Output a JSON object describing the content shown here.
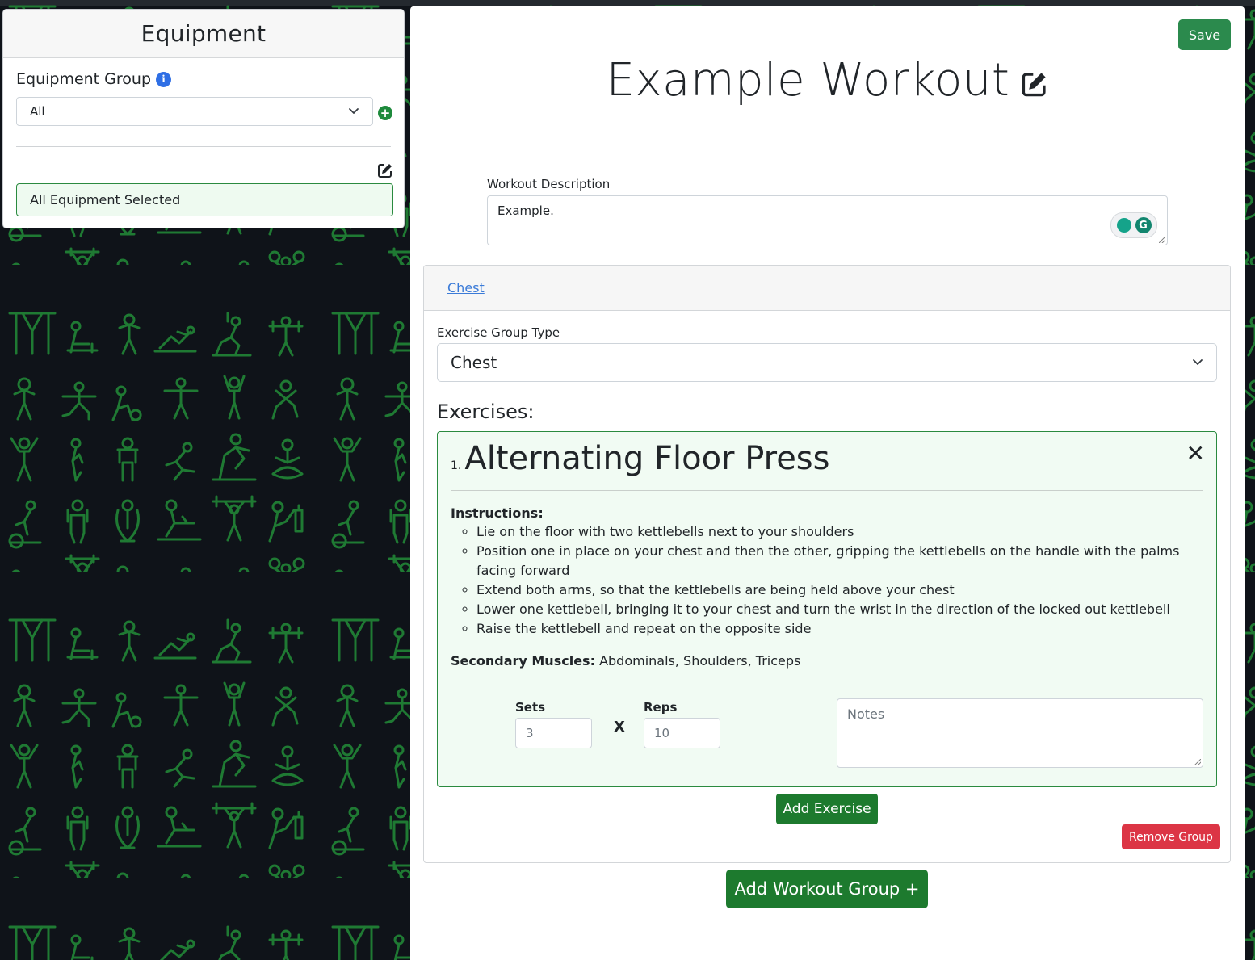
{
  "equipment_panel": {
    "title": "Equipment",
    "group_label": "Equipment Group",
    "group_select_value": "All",
    "selected_text": "All Equipment Selected"
  },
  "workout": {
    "save_label": "Save",
    "title": "Example Workout",
    "description_label": "Workout Description",
    "description_value": "Example.",
    "grammarly_letter": "G"
  },
  "group": {
    "tab_label": "Chest",
    "type_label": "Exercise Group Type",
    "type_value": "Chest",
    "exercises_heading": "Exercises:",
    "remove_label": "Remove Group",
    "add_exercise_label": "Add Exercise"
  },
  "exercise": {
    "number": "1.",
    "name": "Alternating Floor Press",
    "close_glyph": "✕",
    "instructions_heading": "Instructions:",
    "instructions": [
      "Lie on the floor with two kettlebells next to your shoulders",
      "Position one in place on your chest and then the other, gripping the kettlebells on the handle with the palms facing forward",
      "Extend both arms, so that the kettlebells are being held above your chest",
      "Lower one kettlebell, bringing it to your chest and turn the wrist in the direction of the locked out kettlebell",
      "Raise the kettlebell and repeat on the opposite side"
    ],
    "secondary_label": "Secondary Muscles:",
    "secondary_value": "Abdominals, Shoulders, Triceps",
    "sets_label": "Sets",
    "sets_value": "3",
    "x_label": "X",
    "reps_label": "Reps",
    "reps_value": "10",
    "notes_placeholder": "Notes"
  },
  "add_workout_group_label": "Add Workout Group +",
  "colors": {
    "background": "#0f1319",
    "pattern": "#1f7a33",
    "primary_green": "#1d7a2e",
    "danger": "#dc3545",
    "link": "#3b7bd8"
  },
  "icons": [
    "info-icon",
    "add-circle-icon",
    "edit-icon",
    "chevron-down-icon",
    "close-icon",
    "grammarly-icon",
    "fitness-pattern-icons"
  ]
}
